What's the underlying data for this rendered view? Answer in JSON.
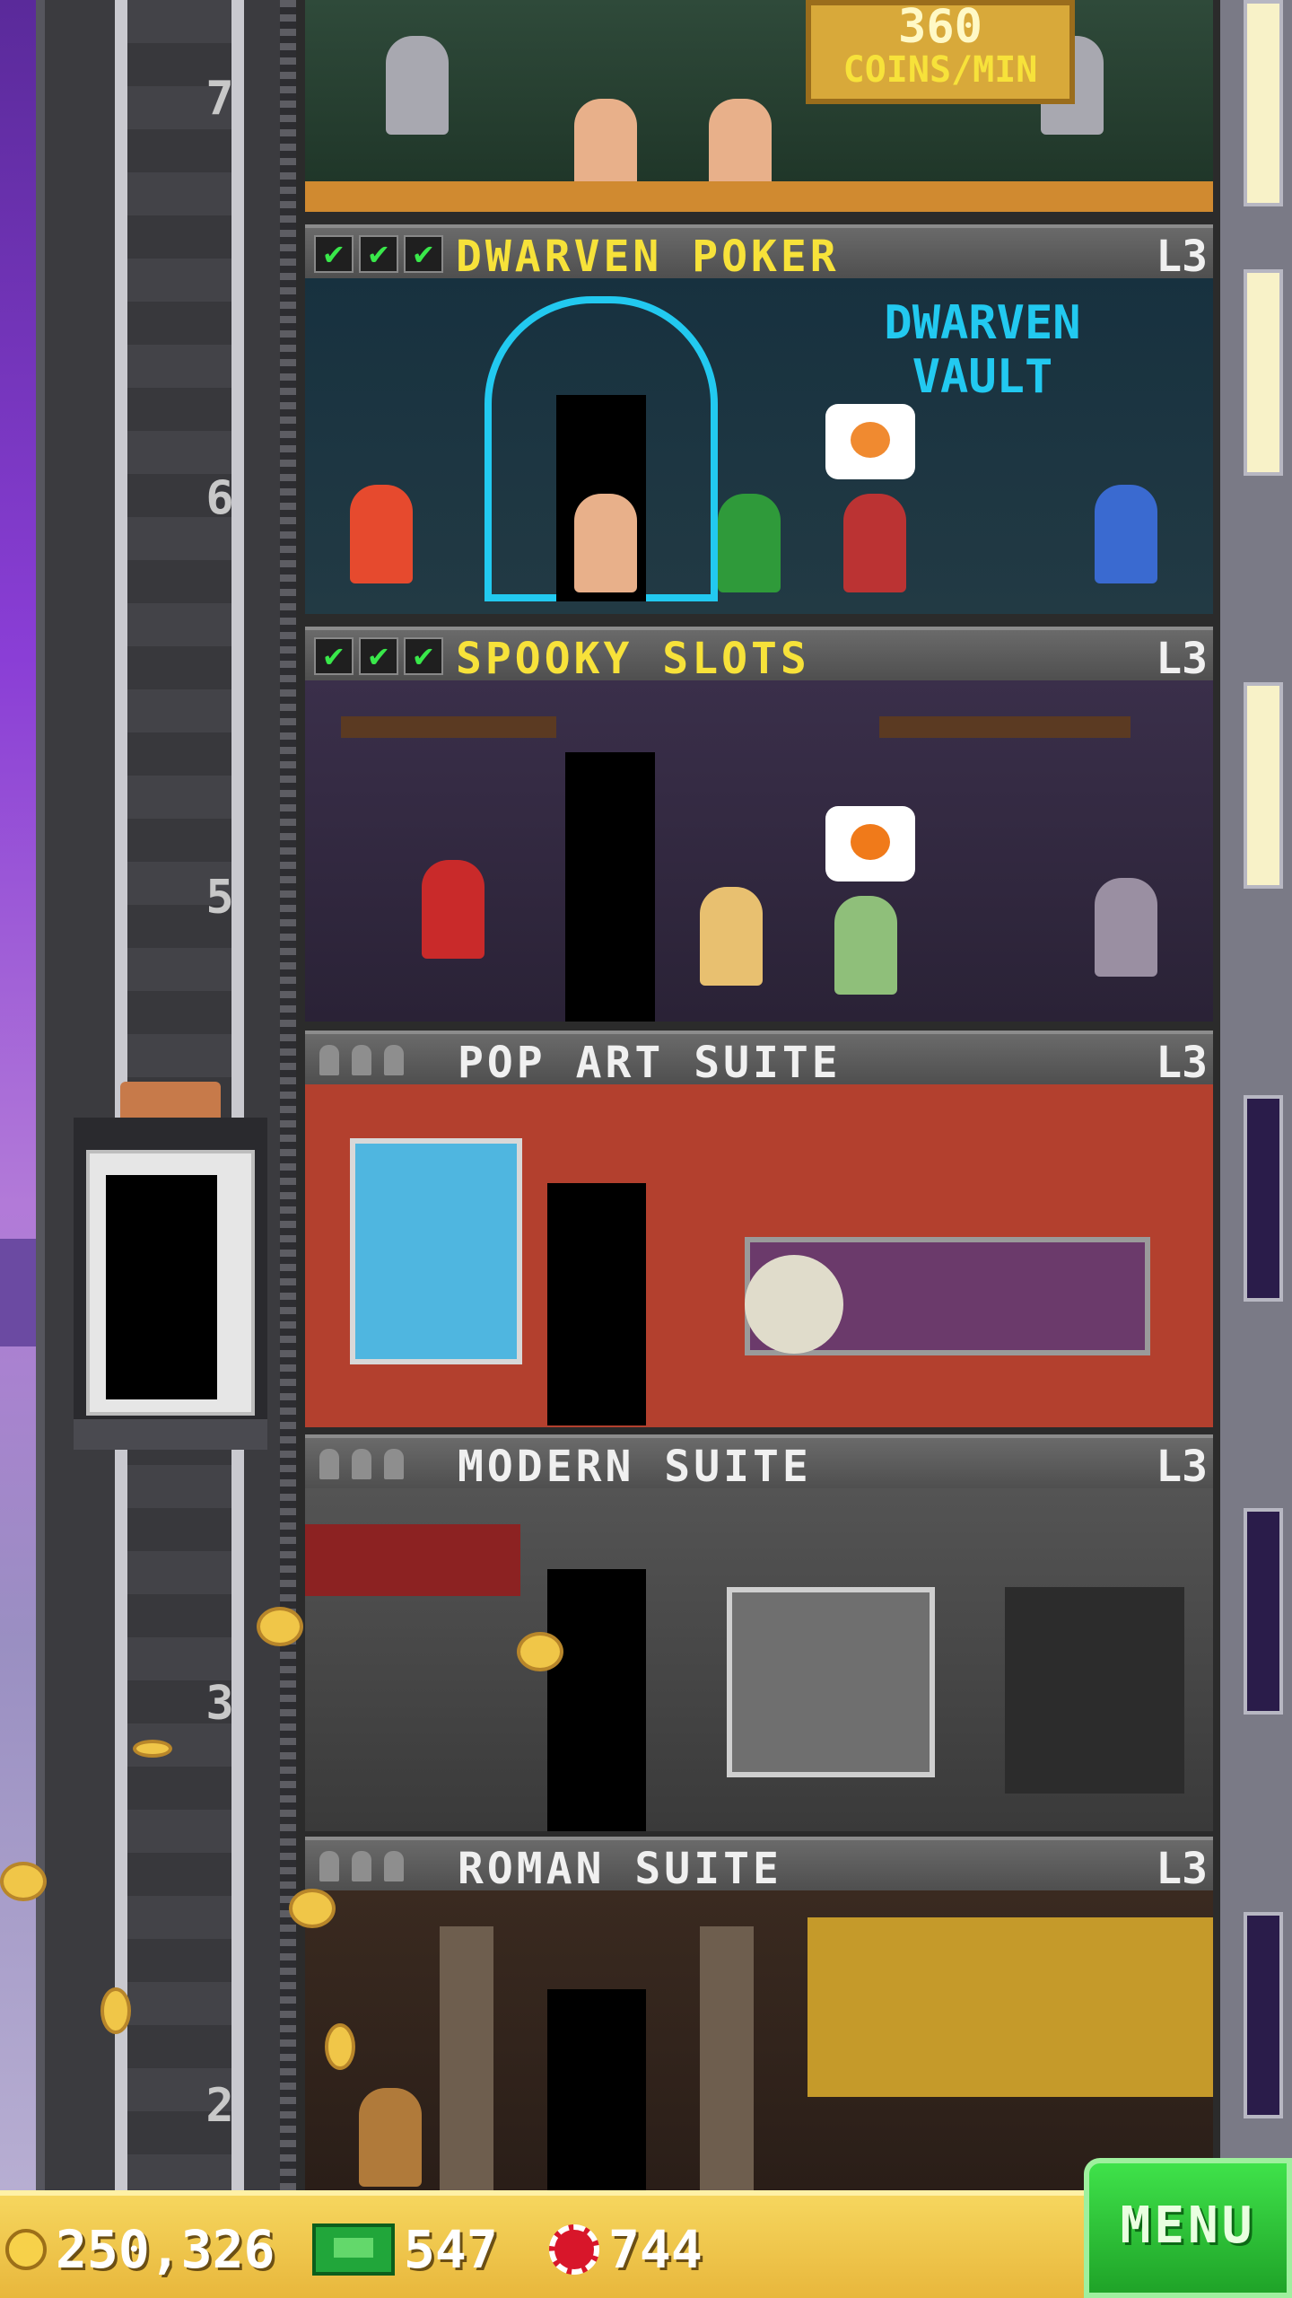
{
  "shaft": {
    "floor_numbers": [
      "7",
      "6",
      "5",
      "3",
      "2"
    ]
  },
  "top_sign": {
    "value": "360",
    "label": "COINS/MIN"
  },
  "floors": [
    {
      "name": "DWARVEN POKER",
      "level": "L3",
      "stocked": 3,
      "style": "gold",
      "room_sign": "DWARVEN VAULT"
    },
    {
      "name": "SPOOKY SLOTS",
      "level": "L3",
      "stocked": 3,
      "style": "gold"
    },
    {
      "name": "POP ART SUITE",
      "level": "L3",
      "residents": 3,
      "style": "white"
    },
    {
      "name": "MODERN SUITE",
      "level": "L3",
      "residents": 3,
      "style": "white"
    },
    {
      "name": "ROMAN SUITE",
      "level": "L3",
      "residents": 3,
      "style": "white"
    }
  ],
  "status": {
    "coins": "250,326",
    "bux": "547",
    "chips": "744"
  },
  "menu_label": "MENU",
  "colors": {
    "accent_gold": "#f7e23a",
    "check_green": "#39e84a",
    "menu_green": "#2fcf3a",
    "bar_gold": "#f0c648"
  },
  "icons": [
    "coin-icon",
    "bux-icon",
    "chip-icon",
    "check-icon"
  ]
}
